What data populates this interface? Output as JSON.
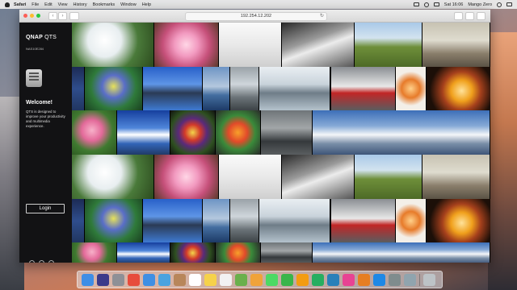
{
  "menubar": {
    "app": "Safari",
    "items": [
      "File",
      "Edit",
      "View",
      "History",
      "Bookmarks",
      "Window",
      "Help"
    ],
    "clock": "Sat 16:06",
    "user": "Mango Zero"
  },
  "browser": {
    "url": "192.254.12.202",
    "back": "‹",
    "forward": "›",
    "reload": "↻"
  },
  "panel": {
    "brand": "QNAP",
    "product": "QTS",
    "nas_name": "NAS10E284",
    "welcome": "Welcome!",
    "description": "QTS is designed to improve your productivity and multimedia experience.",
    "login_label": "Login"
  },
  "wall": {
    "rows": [
      [
        "flower-w",
        "blossom",
        "pier",
        "bw-waves",
        "tractor",
        "industrial"
      ],
      [
        "tall-blue",
        "iris",
        "hut",
        "ocean",
        "river",
        "warehouse",
        "dusk",
        "racecar",
        "drink",
        "carousel"
      ],
      [
        "rose",
        "bluesky",
        "fruit",
        "veggies",
        "canal",
        "panorama"
      ],
      [
        "flower-w",
        "blossom",
        "pier",
        "bw-waves",
        "tractor",
        "industrial"
      ],
      [
        "tall-blue",
        "iris",
        "hut",
        "ocean",
        "river",
        "warehouse",
        "dusk",
        "racecar",
        "drink",
        "carousel"
      ],
      [
        "rose",
        "bluesky",
        "fruit",
        "veggies",
        "canal",
        "panorama"
      ]
    ]
  },
  "dock": {
    "apps": [
      "finder-icon",
      "siri-icon",
      "launchpad-icon",
      "chrome-icon",
      "safari-icon",
      "mail-icon",
      "contacts-icon",
      "calendar-icon",
      "notes-icon",
      "reminders-icon",
      "maps-icon",
      "photos-icon",
      "messages-icon",
      "facetime-icon",
      "pages-icon",
      "numbers-icon",
      "keynote-icon",
      "itunes-icon",
      "ibooks-icon",
      "appstore-icon",
      "settings-icon",
      "preview-icon",
      "trash-icon"
    ],
    "colors": [
      "#3e8ee6",
      "#3a3a8a",
      "#8e9096",
      "#e74c3c",
      "#3f8fe3",
      "#4aa3df",
      "#b8865a",
      "#ffffff",
      "#f6d24a",
      "#f2f2f2",
      "#6ab04c",
      "#f0a33a",
      "#4cd964",
      "#39b54a",
      "#f39c12",
      "#27ae60",
      "#2980b9",
      "#e84393",
      "#e67e22",
      "#1e88e5",
      "#7f8c8d",
      "#90a4ae",
      "#bdc3c7"
    ]
  }
}
